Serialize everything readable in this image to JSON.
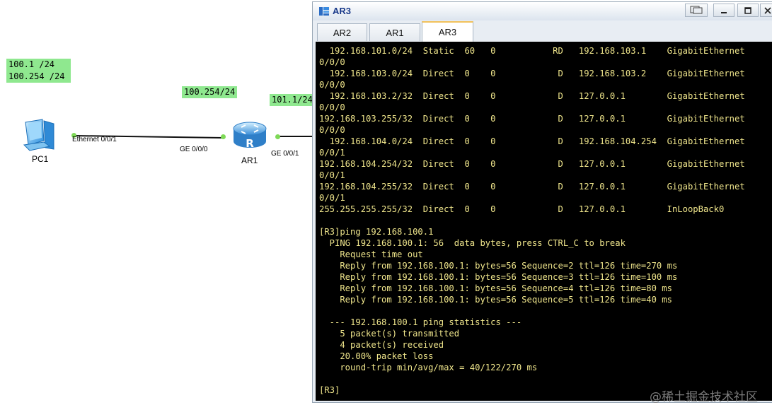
{
  "topology": {
    "pc1_label": "100.1 /24\n100.254 /24",
    "ar1_left_label": "100.254/24",
    "ar1_right_label": "101.1/24",
    "pc1_name": "PC1",
    "ar1_name": "AR1",
    "pc1_port": "Ethernet 0/0/1",
    "ar1_port_left": "GE 0/0/0",
    "ar1_port_right": "GE 0/0/1",
    "colors": {
      "label_bg": "#8fe88f",
      "port_dot": "#7ed957"
    },
    "icons": [
      "pc-icon",
      "router-icon"
    ]
  },
  "window": {
    "title": "AR3",
    "icons": [
      "app-icon",
      "restore-icon",
      "minimize-icon",
      "maximize-icon",
      "close-icon"
    ],
    "tabs": [
      {
        "label": "AR2",
        "active": false
      },
      {
        "label": "AR1",
        "active": false
      },
      {
        "label": "AR3",
        "active": true
      }
    ]
  },
  "terminal": {
    "text_color": "#f0e68c",
    "lines": [
      "  192.168.101.0/24  Static  60   0           RD   192.168.103.1    GigabitEthernet",
      "0/0/0",
      "  192.168.103.0/24  Direct  0    0            D   192.168.103.2    GigabitEthernet",
      "0/0/0",
      "  192.168.103.2/32  Direct  0    0            D   127.0.0.1        GigabitEthernet",
      "0/0/0",
      "192.168.103.255/32  Direct  0    0            D   127.0.0.1        GigabitEthernet",
      "0/0/0",
      "  192.168.104.0/24  Direct  0    0            D   192.168.104.254  GigabitEthernet",
      "0/0/1",
      "192.168.104.254/32  Direct  0    0            D   127.0.0.1        GigabitEthernet",
      "0/0/1",
      "192.168.104.255/32  Direct  0    0            D   127.0.0.1        GigabitEthernet",
      "0/0/1",
      "255.255.255.255/32  Direct  0    0            D   127.0.0.1        InLoopBack0",
      "",
      "[R3]ping 192.168.100.1",
      "  PING 192.168.100.1: 56  data bytes, press CTRL_C to break",
      "    Request time out",
      "    Reply from 192.168.100.1: bytes=56 Sequence=2 ttl=126 time=270 ms",
      "    Reply from 192.168.100.1: bytes=56 Sequence=3 ttl=126 time=100 ms",
      "    Reply from 192.168.100.1: bytes=56 Sequence=4 ttl=126 time=80 ms",
      "    Reply from 192.168.100.1: bytes=56 Sequence=5 ttl=126 time=40 ms",
      "",
      "  --- 192.168.100.1 ping statistics ---",
      "    5 packet(s) transmitted",
      "    4 packet(s) received",
      "    20.00% packet loss",
      "    round-trip min/avg/max = 40/122/270 ms",
      "",
      "[R3]"
    ]
  },
  "watermark": "@稀土掘金技术社区"
}
